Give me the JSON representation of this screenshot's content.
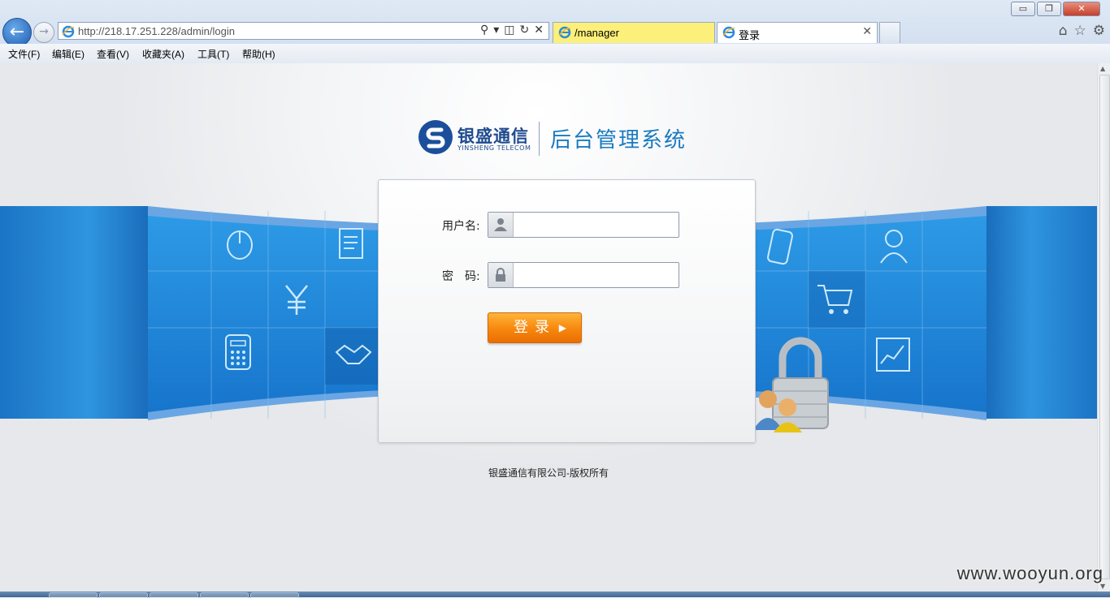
{
  "browser": {
    "url": "http://218.17.251.228/admin/login",
    "tabs": [
      {
        "label": "/manager"
      },
      {
        "label": "登录"
      }
    ],
    "menu": [
      "文件(F)",
      "编辑(E)",
      "查看(V)",
      "收藏夹(A)",
      "工具(T)",
      "帮助(H)"
    ],
    "window_buttons": {
      "minimize": "▭",
      "restore": "❐",
      "close": "✕"
    }
  },
  "page": {
    "brand_cn": "银盛通信",
    "brand_en": "YINSHENG TELECOM",
    "system_title": "后台管理系统",
    "login": {
      "username_label": "用户名:",
      "password_label": "密　码:",
      "username_value": "",
      "password_value": "",
      "submit_label": "登录",
      "submit_arrow": "▶"
    },
    "copyright": "银盛通信有限公司-版权所有"
  },
  "watermark": "www.wooyun.org",
  "colors": {
    "brand_blue": "#1f4b8e",
    "title_blue": "#1a7bc0",
    "band_blue": "#2f95e0",
    "button_orange": "#f88a10",
    "tab_active_yellow": "#fdf07a"
  },
  "icons": {
    "band_tiles": [
      "mouse-icon",
      "document-icon",
      "yen-icon",
      "handshake-icon",
      "calculator-icon",
      "mobile-icon",
      "person-icon",
      "cart-icon",
      "chart-icon"
    ],
    "lock": "padlock-users-icon"
  }
}
